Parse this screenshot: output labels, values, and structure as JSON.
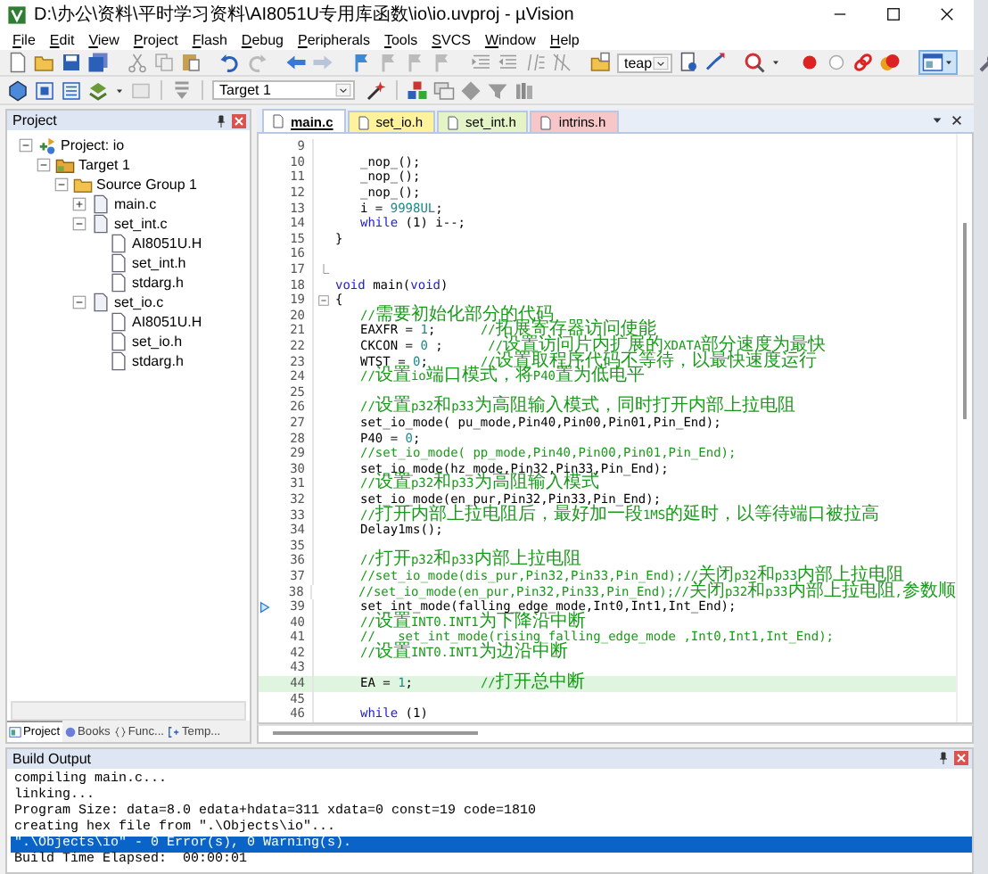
{
  "window": {
    "title": "D:\\办公\\资料\\平时学习资料\\AI8051U专用库函数\\io\\io.uvproj - µVision"
  },
  "menu": [
    "File",
    "Edit",
    "View",
    "Project",
    "Flash",
    "Debug",
    "Peripherals",
    "Tools",
    "SVCS",
    "Window",
    "Help"
  ],
  "toolbar": {
    "find_combo": "teap",
    "target_combo": "Target 1"
  },
  "project_panel": {
    "title": "Project",
    "tree": [
      {
        "label": "Project: io",
        "kind": "project",
        "expanded": true,
        "children": [
          {
            "label": "Target 1",
            "kind": "target",
            "expanded": true,
            "children": [
              {
                "label": "Source Group 1",
                "kind": "group",
                "expanded": true,
                "children": [
                  {
                    "label": "main.c",
                    "kind": "source",
                    "expanded": false
                  },
                  {
                    "label": "set_int.c",
                    "kind": "source",
                    "expanded": true,
                    "children": [
                      {
                        "label": "AI8051U.H",
                        "kind": "header"
                      },
                      {
                        "label": "set_int.h",
                        "kind": "header"
                      },
                      {
                        "label": "stdarg.h",
                        "kind": "header"
                      }
                    ]
                  },
                  {
                    "label": "set_io.c",
                    "kind": "source",
                    "expanded": true,
                    "children": [
                      {
                        "label": "AI8051U.H",
                        "kind": "header"
                      },
                      {
                        "label": "set_io.h",
                        "kind": "header"
                      },
                      {
                        "label": "stdarg.h",
                        "kind": "header"
                      }
                    ]
                  }
                ]
              }
            ]
          }
        ]
      }
    ],
    "tabs": [
      {
        "label": "Project",
        "selected": true
      },
      {
        "label": "Books",
        "selected": false
      },
      {
        "label": "Func...",
        "selected": false
      },
      {
        "label": "Temp...",
        "selected": false
      }
    ]
  },
  "editor": {
    "tabs": [
      {
        "label": "main.c",
        "selected": true,
        "color": "#ffffff"
      },
      {
        "label": "set_io.h",
        "selected": false,
        "color": "#fff29c"
      },
      {
        "label": "set_int.h",
        "selected": false,
        "color": "#e4f4c6"
      },
      {
        "label": "intrins.h",
        "selected": false,
        "color": "#f7c6c9"
      }
    ],
    "lines": [
      {
        "number": "9"
      },
      {
        "number": "10",
        "indented": true,
        "parts": [
          {
            "kind": "plain",
            "text": "_nop_();"
          }
        ]
      },
      {
        "number": "11",
        "indented": true,
        "parts": [
          {
            "kind": "plain",
            "text": "_nop_();"
          }
        ]
      },
      {
        "number": "12",
        "indented": true,
        "parts": [
          {
            "kind": "plain",
            "text": "_nop_();"
          }
        ]
      },
      {
        "number": "13",
        "indented": true,
        "parts": [
          {
            "kind": "plain",
            "text": "i = "
          },
          {
            "kind": "number",
            "text": "9998UL"
          },
          {
            "kind": "plain",
            "text": ";"
          }
        ]
      },
      {
        "number": "14",
        "indented": true,
        "parts": [
          {
            "kind": "keyword",
            "text": "while"
          },
          {
            "kind": "plain",
            "text": " (1) i--;"
          }
        ]
      },
      {
        "number": "15",
        "parts": [
          {
            "kind": "plain",
            "text": "}"
          }
        ]
      },
      {
        "number": "16"
      },
      {
        "number": "17",
        "fold_end": true
      },
      {
        "number": "18",
        "parts": [
          {
            "kind": "keyword",
            "text": "void"
          },
          {
            "kind": "plain",
            "text": " main("
          },
          {
            "kind": "keyword",
            "text": "void"
          },
          {
            "kind": "plain",
            "text": ")"
          }
        ]
      },
      {
        "number": "19",
        "fold_start": true,
        "parts": [
          {
            "kind": "plain",
            "text": "{"
          }
        ]
      },
      {
        "number": "20",
        "indented": true,
        "parts": [
          {
            "kind": "comment",
            "text": "//需要初始化部分的代码"
          }
        ]
      },
      {
        "number": "21",
        "indented": true,
        "parts": [
          {
            "kind": "plain",
            "text": "EAXFR = "
          },
          {
            "kind": "number",
            "text": "1"
          },
          {
            "kind": "plain",
            "text": ";      "
          },
          {
            "kind": "comment",
            "text": "//拓展寄存器访问使能"
          }
        ]
      },
      {
        "number": "22",
        "indented": true,
        "parts": [
          {
            "kind": "plain",
            "text": "CKCON = "
          },
          {
            "kind": "number",
            "text": "0"
          },
          {
            "kind": "plain",
            "text": " ;      "
          },
          {
            "kind": "comment",
            "text": "//设置访问片内扩展的XDATA部分速度为最快"
          }
        ]
      },
      {
        "number": "23",
        "indented": true,
        "parts": [
          {
            "kind": "plain",
            "text": "WTST = "
          },
          {
            "kind": "number",
            "text": "0"
          },
          {
            "kind": "plain",
            "text": ";       "
          },
          {
            "kind": "comment",
            "text": "//设置取程序代码不等待，以最快速度运行"
          }
        ]
      },
      {
        "number": "24",
        "indented": true,
        "parts": [
          {
            "kind": "comment",
            "text": "//设置io端口模式，将P40置为低电平"
          }
        ]
      },
      {
        "number": "25"
      },
      {
        "number": "26",
        "indented": true,
        "parts": [
          {
            "kind": "comment",
            "text": "//设置p32和p33为高阻输入模式，同时打开内部上拉电阻"
          }
        ]
      },
      {
        "number": "27",
        "indented": true,
        "parts": [
          {
            "kind": "plain",
            "text": "set_io_mode( pu_mode,Pin40,Pin00,Pin01,Pin_End);"
          }
        ]
      },
      {
        "number": "28",
        "indented": true,
        "parts": [
          {
            "kind": "plain",
            "text": "P40 = "
          },
          {
            "kind": "number",
            "text": "0"
          },
          {
            "kind": "plain",
            "text": ";"
          }
        ]
      },
      {
        "number": "29",
        "indented": true,
        "parts": [
          {
            "kind": "comment",
            "text": "//set_io_mode( pp_mode,Pin40,Pin00,Pin01,Pin_End);"
          }
        ]
      },
      {
        "number": "30",
        "indented": true,
        "parts": [
          {
            "kind": "plain",
            "text": "set_io_mode(hz_mode,Pin32,Pin33,Pin_End);"
          }
        ]
      },
      {
        "number": "31",
        "indented": true,
        "parts": [
          {
            "kind": "comment",
            "text": "//设置p32和p33为高阻输入模式"
          }
        ]
      },
      {
        "number": "32",
        "indented": true,
        "parts": [
          {
            "kind": "plain",
            "text": "set_io_mode(en_pur,Pin32,Pin33,Pin_End);"
          }
        ]
      },
      {
        "number": "33",
        "indented": true,
        "parts": [
          {
            "kind": "comment",
            "text": "//打开内部上拉电阻后，最好加一段1MS的延时，以等待端口被拉高"
          }
        ]
      },
      {
        "number": "34",
        "indented": true,
        "parts": [
          {
            "kind": "plain",
            "text": "Delay1ms();"
          }
        ]
      },
      {
        "number": "35"
      },
      {
        "number": "36",
        "indented": true,
        "parts": [
          {
            "kind": "comment",
            "text": "//打开p32和p33内部上拉电阻"
          }
        ]
      },
      {
        "number": "37",
        "indented": true,
        "parts": [
          {
            "kind": "comment",
            "text": "//set_io_mode(dis_pur,Pin32,Pin33,Pin_End);//关闭p32和p33内部上拉电阻"
          }
        ]
      },
      {
        "number": "38",
        "indented": true,
        "parts": [
          {
            "kind": "comment",
            "text": "//set_io_mode(en_pur,Pin32,Pin33,Pin_End);//关闭p32和p33内部上拉电阻,参数顺"
          }
        ]
      },
      {
        "number": "39",
        "indented": true,
        "pointer": true,
        "parts": [
          {
            "kind": "plain",
            "text": "set_int_mode(falling_edge_mode,Int0,Int1,Int_End);"
          }
        ]
      },
      {
        "number": "40",
        "indented": true,
        "parts": [
          {
            "kind": "comment",
            "text": "//设置INT0.INT1为下降沿中断"
          }
        ]
      },
      {
        "number": "41",
        "indented": true,
        "parts": [
          {
            "kind": "comment",
            "text": "//   set_int_mode(rising_falling_edge_mode ,Int0,Int1,Int_End);"
          }
        ]
      },
      {
        "number": "42",
        "indented": true,
        "parts": [
          {
            "kind": "comment",
            "text": "//设置INT0.INT1为边沿中断"
          }
        ]
      },
      {
        "number": "43"
      },
      {
        "number": "44",
        "indented": true,
        "current": true,
        "parts": [
          {
            "kind": "plain",
            "text": "EA = "
          },
          {
            "kind": "number",
            "text": "1"
          },
          {
            "kind": "plain",
            "text": ";         "
          },
          {
            "kind": "comment",
            "text": "//打开总中断"
          }
        ]
      },
      {
        "number": "45"
      },
      {
        "number": "46",
        "indented": true,
        "parts": [
          {
            "kind": "keyword",
            "text": "while"
          },
          {
            "kind": "plain",
            "text": " (1)"
          }
        ]
      }
    ]
  },
  "build_output": {
    "title": "Build Output",
    "lines": [
      {
        "text": "compiling main.c...",
        "selected": false
      },
      {
        "text": "linking...",
        "selected": false
      },
      {
        "text": "Program Size: data=8.0 edata+hdata=311 xdata=0 const=19 code=1810",
        "selected": false
      },
      {
        "text": "creating hex file from \".\\Objects\\io\"...",
        "selected": false
      },
      {
        "text": "\".\\Objects\\io\" - 0 Error(s), 0 Warning(s).",
        "selected": true
      },
      {
        "text": "Build Time Elapsed:  00:00:01",
        "selected": false
      }
    ]
  }
}
